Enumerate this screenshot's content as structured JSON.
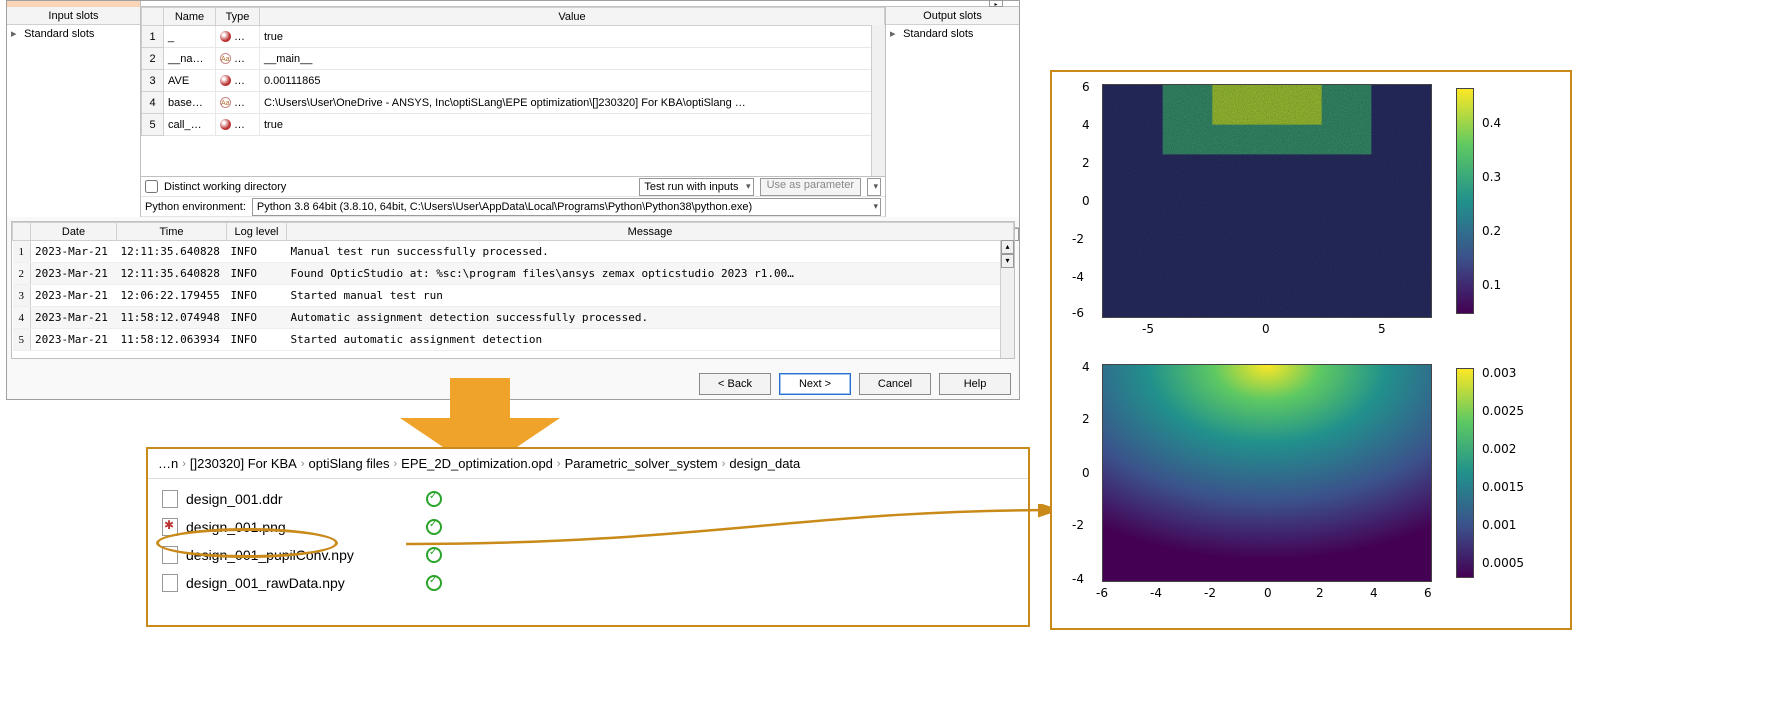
{
  "panels": {
    "input_slots_title": "Input slots",
    "output_slots_title": "Output slots",
    "standard_slots_label": "Standard slots"
  },
  "var_table": {
    "headers": {
      "name": "Name",
      "type": "Type",
      "value": "Value"
    },
    "rows": [
      {
        "n": "1",
        "name": "_",
        "type": "bool",
        "value": "true"
      },
      {
        "n": "2",
        "name": "__na…",
        "type": "str",
        "value": "__main__"
      },
      {
        "n": "3",
        "name": "AVE",
        "type": "bool",
        "value": "0.00111865"
      },
      {
        "n": "4",
        "name": "base…",
        "type": "str",
        "value": "C:\\Users\\User\\OneDrive - ANSYS, Inc\\optiSLang\\EPE optimization\\[]230320] For KBA\\optiSlang …"
      },
      {
        "n": "5",
        "name": "call_…",
        "type": "bool",
        "value": "true"
      }
    ]
  },
  "center_bottom": {
    "distinct_wd": "Distinct working directory",
    "test_run": "Test run with inputs",
    "use_param": "Use as parameter",
    "py_env_label": "Python environment:",
    "py_env_value": "Python 3.8 64bit (3.8.10, 64bit, C:\\Users\\User\\AppData\\Local\\Programs\\Python\\Python38\\python.exe)"
  },
  "log": {
    "headers": {
      "date": "Date",
      "time": "Time",
      "level": "Log level",
      "msg": "Message"
    },
    "rows": [
      {
        "n": "1",
        "date": "2023-Mar-21",
        "time": "12:11:35.640828",
        "level": "INFO",
        "msg": "Manual test run successfully processed."
      },
      {
        "n": "2",
        "date": "2023-Mar-21",
        "time": "12:11:35.640828",
        "level": "INFO",
        "msg": "Found OpticStudio at:   %sc:\\program files\\ansys zemax opticstudio 2023 r1.00…"
      },
      {
        "n": "3",
        "date": "2023-Mar-21",
        "time": "12:06:22.179455",
        "level": "INFO",
        "msg": "Started manual test run"
      },
      {
        "n": "4",
        "date": "2023-Mar-21",
        "time": "11:58:12.074948",
        "level": "INFO",
        "msg": "Automatic assignment detection successfully processed."
      },
      {
        "n": "5",
        "date": "2023-Mar-21",
        "time": "11:58:12.063934",
        "level": "INFO",
        "msg": "Started automatic assignment detection"
      }
    ]
  },
  "footer": {
    "back": "< Back",
    "next": "Next >",
    "cancel": "Cancel",
    "help": "Help"
  },
  "breadcrumb": {
    "seg0": "…n",
    "seg1": "[]230320] For KBA",
    "seg2": "optiSlang files",
    "seg3": "EPE_2D_optimization.opd",
    "seg4": "Parametric_solver_system",
    "seg5": "design_data"
  },
  "files": {
    "f1": "design_001.ddr",
    "f2": "design_001.png",
    "f3": "design_001_pupilConv.npy",
    "f4": "design_001_rawData.npy"
  },
  "chart_data": [
    {
      "type": "heatmap",
      "xlim": [
        -7,
        7
      ],
      "ylim": [
        -6,
        6
      ],
      "x_ticks": [
        -5,
        0,
        5
      ],
      "y_ticks": [
        -6,
        -4,
        -2,
        0,
        2,
        4,
        6
      ],
      "cbar_ticks": [
        0.1,
        0.2,
        0.3,
        0.4
      ],
      "note": "noisy field; values near 0.4 concentrated at top centre, fading to ~0.05 toward bottom"
    },
    {
      "type": "heatmap",
      "xlim": [
        -6,
        6
      ],
      "ylim": [
        -4,
        4
      ],
      "x_ticks": [
        -6,
        -4,
        -2,
        0,
        2,
        4,
        6
      ],
      "y_ticks": [
        -4,
        -2,
        0,
        2,
        4
      ],
      "cbar_ticks": [
        0.0005,
        0.001,
        0.0015,
        0.002,
        0.0025,
        0.003
      ],
      "note": "smooth gaussian-like peak ~0.003 at top centre fading to ~0.0005 at bottom corners"
    }
  ]
}
